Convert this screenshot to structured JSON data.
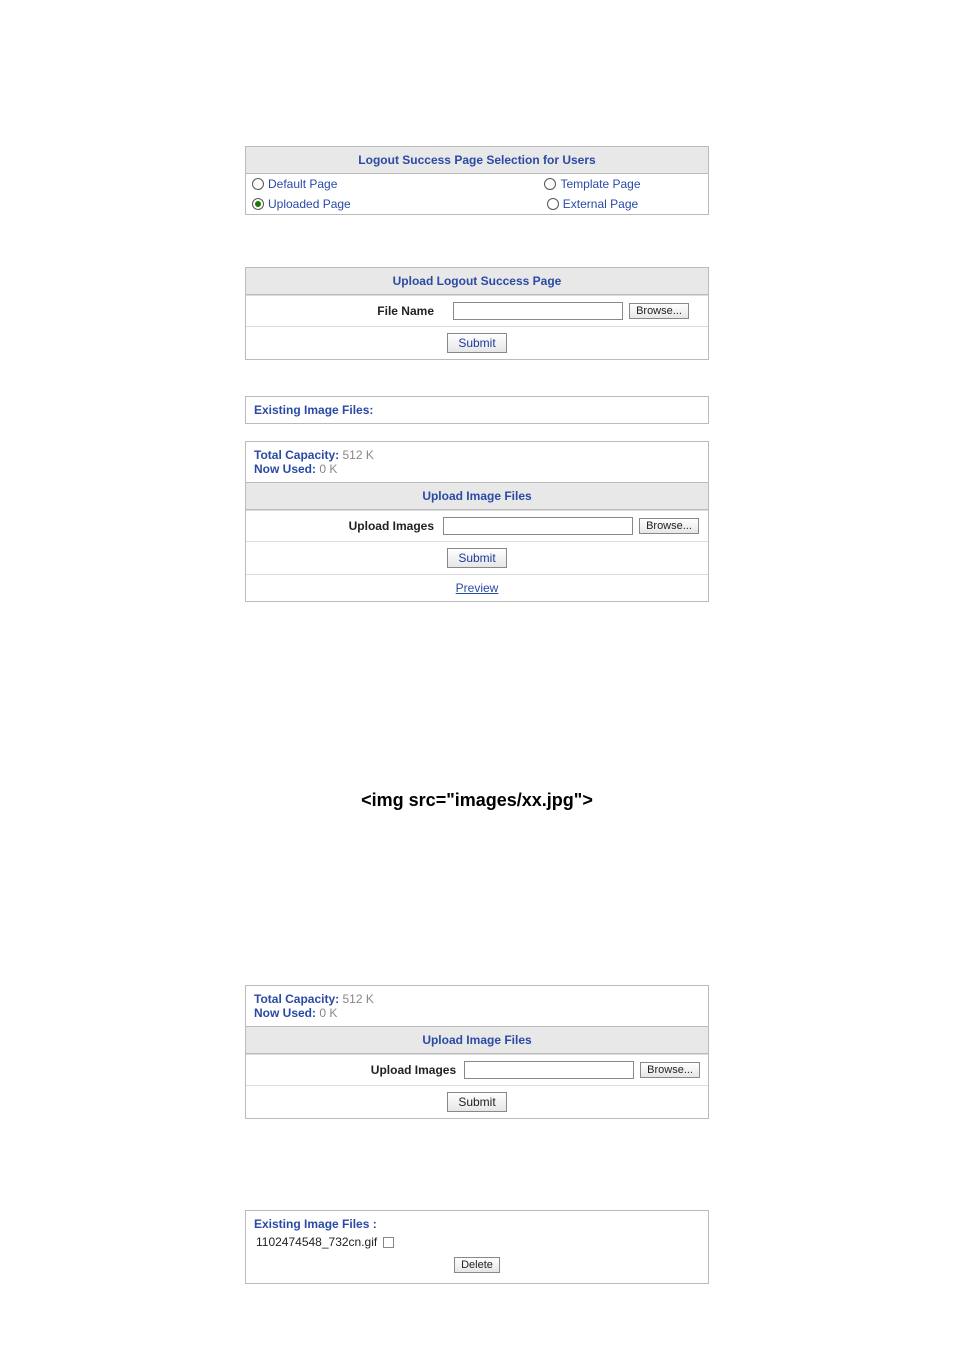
{
  "selection": {
    "header": "Logout Success Page Selection for Users",
    "options": {
      "default": "Default Page",
      "template": "Template Page",
      "uploaded": "Uploaded Page",
      "external": "External Page"
    },
    "selected": "uploaded"
  },
  "upload_page": {
    "header": "Upload Logout Success Page",
    "file_label": "File Name",
    "browse": "Browse...",
    "submit": "Submit"
  },
  "existing1": {
    "header": "Existing Image Files:"
  },
  "images1": {
    "capacity_label": "Total Capacity:",
    "capacity_value": "512 K",
    "used_label": "Now Used:",
    "used_value": "0 K",
    "header": "Upload Image Files",
    "upload_label": "Upload Images",
    "browse": "Browse...",
    "submit": "Submit",
    "preview": "Preview"
  },
  "fig_code": "<img src=\"images/xx.jpg\">",
  "images2": {
    "capacity_label": "Total Capacity:",
    "capacity_value": "512 K",
    "used_label": "Now Used:",
    "used_value": "0 K",
    "header": "Upload Image Files",
    "upload_label": "Upload Images",
    "browse": "Browse...",
    "submit": "Submit"
  },
  "existing2": {
    "header": "Existing Image Files :",
    "files": [
      "1102474548_732cn.gif"
    ],
    "delete": "Delete"
  }
}
